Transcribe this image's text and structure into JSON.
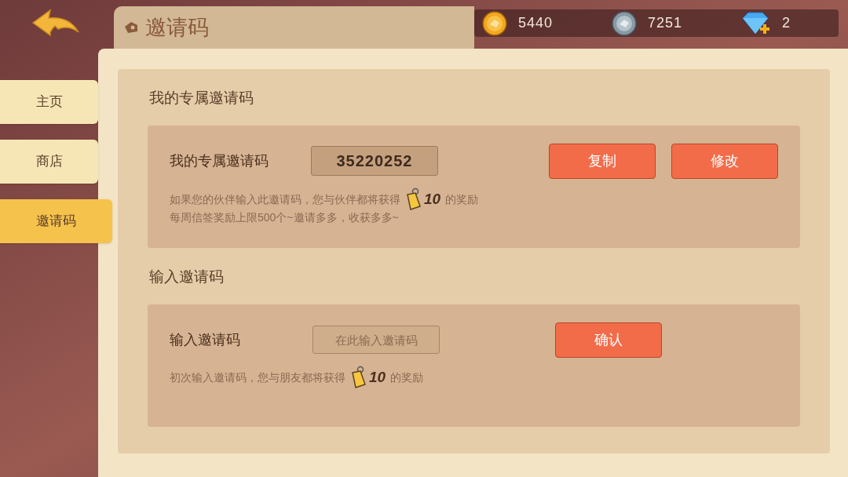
{
  "header": {
    "title": "邀请码"
  },
  "currencies": [
    {
      "kind": "gold",
      "value": "5440"
    },
    {
      "kind": "silver",
      "value": "7251"
    },
    {
      "kind": "gem",
      "value": "2"
    }
  ],
  "sidebar": {
    "items": [
      {
        "label": "主页",
        "selected": false
      },
      {
        "label": "商店",
        "selected": false
      },
      {
        "label": "邀请码",
        "selected": true
      }
    ]
  },
  "my_code": {
    "heading": "我的专属邀请码",
    "label": "我的专属邀请码",
    "code": "35220252",
    "buttons": [
      "复制",
      "修改"
    ],
    "reward_note": {
      "before": "如果您的伙伴输入此邀请码，您与伙伴都将获得",
      "amount": "10",
      "after": "的奖励"
    },
    "limit_note": "每周信签奖励上限500个~邀请多多，收获多多~"
  },
  "enter_code": {
    "heading": "输入邀请码",
    "label": "输入邀请码",
    "placeholder": "在此输入邀请码",
    "button": "确认",
    "reward_note": {
      "before": "初次输入邀请码，您与朋友都将获得",
      "amount": "10",
      "after": "的奖励"
    }
  }
}
